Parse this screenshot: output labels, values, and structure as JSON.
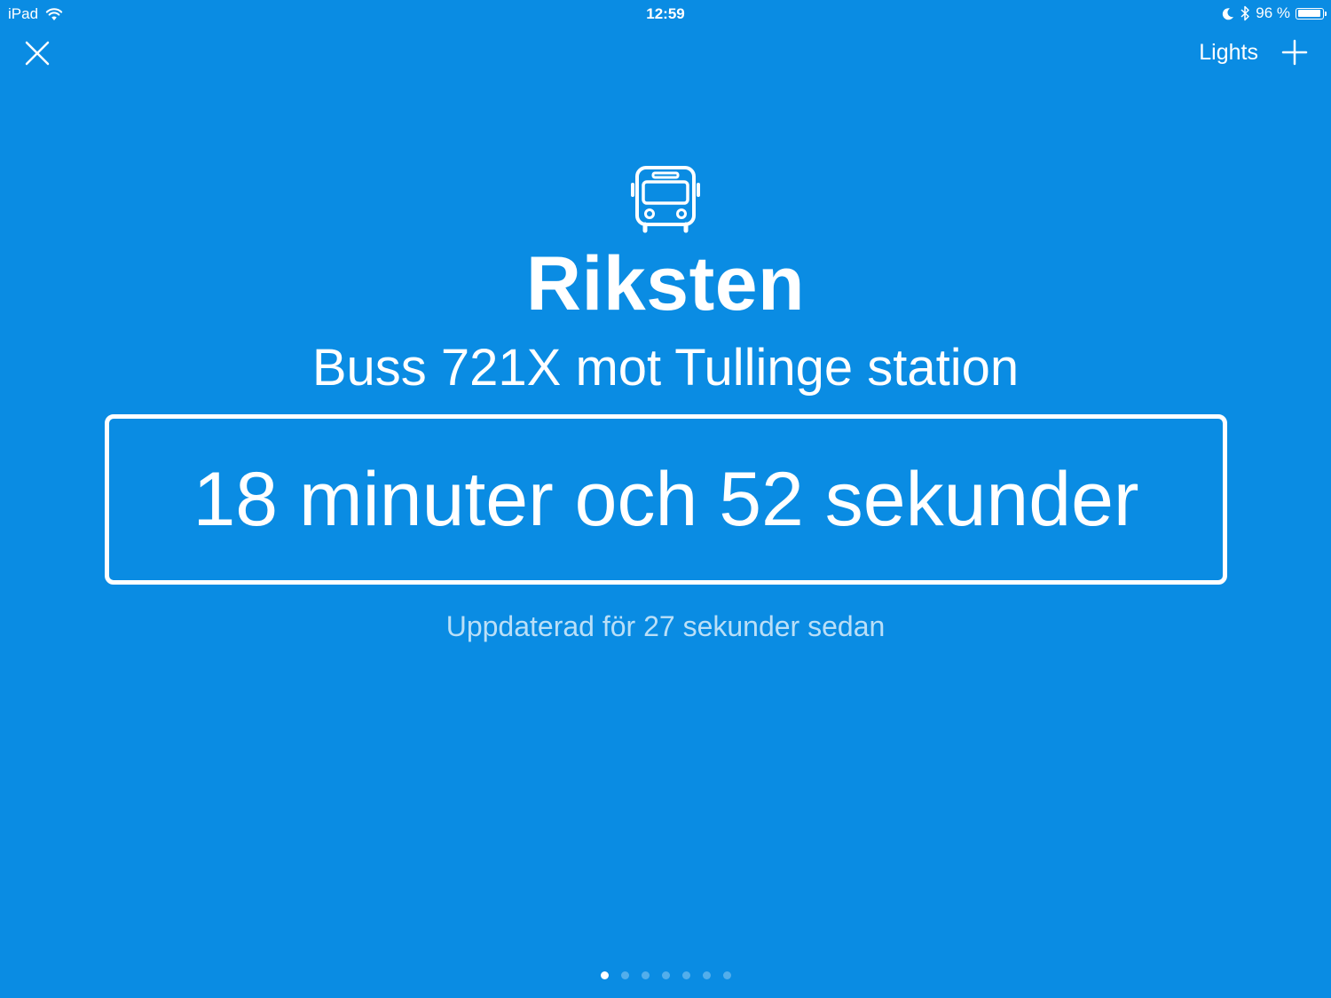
{
  "status_bar": {
    "device": "iPad",
    "time": "12:59",
    "battery_percent": "96 %",
    "battery_level": 0.96,
    "icons": [
      "wifi-icon",
      "moon-icon",
      "bluetooth-icon",
      "battery-icon"
    ]
  },
  "nav": {
    "close_icon": "close-icon",
    "lights_label": "Lights",
    "add_icon": "plus-icon"
  },
  "departure": {
    "icon": "bus-icon",
    "stop_name": "Riksten",
    "route": "Buss 721X mot Tullinge station",
    "countdown": "18 minuter och 52 sekunder",
    "updated": "Uppdaterad för 27 sekunder sedan"
  },
  "pagination": {
    "total": 7,
    "active_index": 0
  },
  "colors": {
    "background": "#0a8ce3",
    "foreground": "#ffffff"
  }
}
